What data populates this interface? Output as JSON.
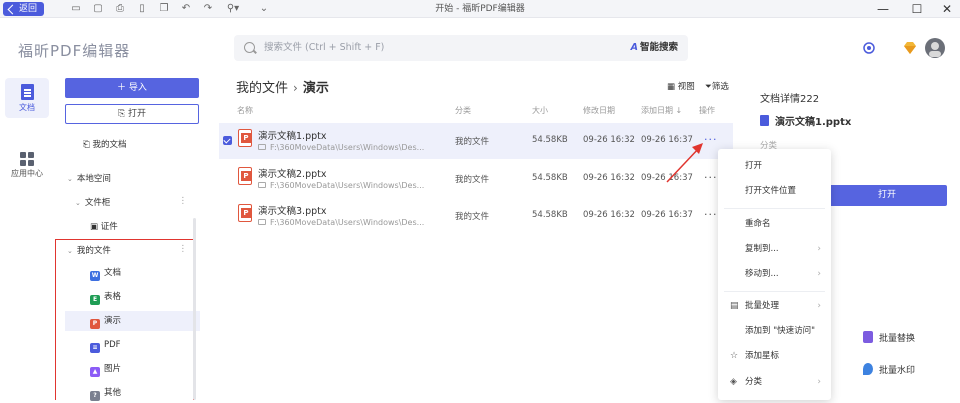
{
  "titlebar": {
    "back_label": "返回",
    "window_title": "开始 - 福昕PDF编辑器",
    "controls": {
      "minimize": "—",
      "maximize": "☐",
      "close": "✕"
    }
  },
  "header": {
    "app_name": "福昕PDF编辑器",
    "search_placeholder": "搜索文件 (Ctrl + Shift + F)",
    "ai_search": "智能搜索"
  },
  "rail": {
    "items": [
      {
        "label": "文档",
        "icon": "document-icon",
        "active": true
      },
      {
        "label": "应用中心",
        "icon": "apps-grid-icon",
        "active": false
      }
    ]
  },
  "sidebar": {
    "import_label": "导入",
    "open_label": "打开",
    "my_docs": "我的文档",
    "local_space": "本地空间",
    "folder": "文件柜",
    "certificate": "证件",
    "my_files": "我的文件",
    "file_types": [
      {
        "label": "文档",
        "color": "#3d6fe0",
        "glyph": "W"
      },
      {
        "label": "表格",
        "color": "#1f9d55",
        "glyph": "E"
      },
      {
        "label": "演示",
        "color": "#e0573e",
        "glyph": "P"
      },
      {
        "label": "PDF",
        "color": "#4b5bdc",
        "glyph": "≡"
      },
      {
        "label": "图片",
        "color": "#8b5cf6",
        "glyph": "▲"
      },
      {
        "label": "其他",
        "color": "#7a8090",
        "glyph": "?"
      }
    ]
  },
  "main": {
    "breadcrumb_parent": "我的文件",
    "breadcrumb_current": "演示",
    "view_label": "视图",
    "filter_label": "筛选",
    "columns": {
      "name": "名称",
      "category": "分类",
      "size": "大小",
      "modified": "修改日期",
      "added": "添加日期",
      "actions": "操作"
    },
    "files": [
      {
        "name": "演示文稿1.pptx",
        "path": "F:\\360MoveData\\Users\\Windows\\Des...",
        "category": "我的文件",
        "size": "54.58KB",
        "modified": "09-26 16:32",
        "added": "09-26 16:37",
        "selected": true
      },
      {
        "name": "演示文稿2.pptx",
        "path": "F:\\360MoveData\\Users\\Windows\\Des...",
        "category": "我的文件",
        "size": "54.58KB",
        "modified": "09-26 16:32",
        "added": "09-26 16:37",
        "selected": false
      },
      {
        "name": "演示文稿3.pptx",
        "path": "F:\\360MoveData\\Users\\Windows\\Des...",
        "category": "我的文件",
        "size": "54.58KB",
        "modified": "09-26 16:32",
        "added": "09-26 16:37",
        "selected": false
      }
    ]
  },
  "context_menu": {
    "open": "打开",
    "open_location": "打开文件位置",
    "rename": "重命名",
    "copy_to": "复制到...",
    "move_to": "移动到...",
    "batch": "批量处理",
    "add_quick": "添加到 \"快速访问\"",
    "add_star": "添加星标",
    "category": "分类"
  },
  "detail": {
    "title": "文档详情222",
    "file_name": "演示文稿1.pptx",
    "label_category": "分类",
    "open_label": "打开",
    "tools": [
      {
        "label": "批量替换",
        "color": "#7c5ce0"
      },
      {
        "label": "批量水印",
        "color": "#3d82e0"
      }
    ]
  }
}
